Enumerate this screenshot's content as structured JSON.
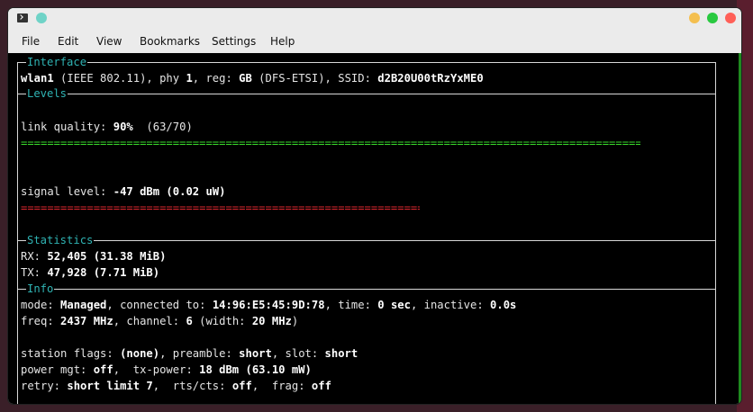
{
  "menu": [
    "File",
    "Edit",
    "View",
    "Bookmarks",
    "Settings",
    "Help"
  ],
  "sections": {
    "interface": "Interface",
    "levels": "Levels",
    "statistics": "Statistics",
    "info": "Info"
  },
  "interface": {
    "name": "wlan1",
    "proto": " (IEEE 802.11), phy ",
    "phy": "1",
    "reg_label": ", reg: ",
    "reg": "GB",
    "reg_extra": " (DFS-ETSI), SSID: ",
    "ssid": "d2B20U00tRzYxME0"
  },
  "levels": {
    "link_quality_label": "link quality: ",
    "link_quality_pct": "90%",
    "link_quality_raw": "  (63/70)",
    "link_quality_fraction": 0.9,
    "signal_level_label": "signal level: ",
    "signal_level_value": "-47 dBm (0.02 uW)",
    "signal_level_fraction": 0.58
  },
  "statistics": {
    "rx_label": "RX: ",
    "rx_value": "52,405 (31.38 MiB)",
    "tx_label": "TX: ",
    "tx_value": "47,928 (7.71 MiB)"
  },
  "info": {
    "mode_label": "mode: ",
    "mode": "Managed",
    "connected_label": ", connected to: ",
    "connected": "14:96:E5:45:9D:78",
    "time_label": ", time: ",
    "time": "0 sec",
    "inactive_label": ", inactive: ",
    "inactive": "0.0s",
    "freq_label": "freq: ",
    "freq": "2437 MHz",
    "channel_label": ", channel: ",
    "channel": "6",
    "width_label": " (width: ",
    "width": "20 MHz",
    "width_close": ")",
    "flags_label": "station flags: ",
    "flags": "(none)",
    "preamble_label": ", preamble: ",
    "preamble": "short",
    "slot_label": ", slot: ",
    "slot": "short",
    "power_label": "power mgt: ",
    "power": "off",
    "txpower_label": ",  tx-power: ",
    "txpower": "18 dBm (63.10 mW)",
    "retry_label": "retry: ",
    "retry": "short limit 7",
    "rts_label": ",  rts/cts: ",
    "rts": "off",
    "frag_label": ",  frag: ",
    "frag": "off"
  },
  "colors": {
    "section": "#2fb3b3",
    "good_bar": "#39d92b",
    "bad_bar": "#e0282f"
  }
}
